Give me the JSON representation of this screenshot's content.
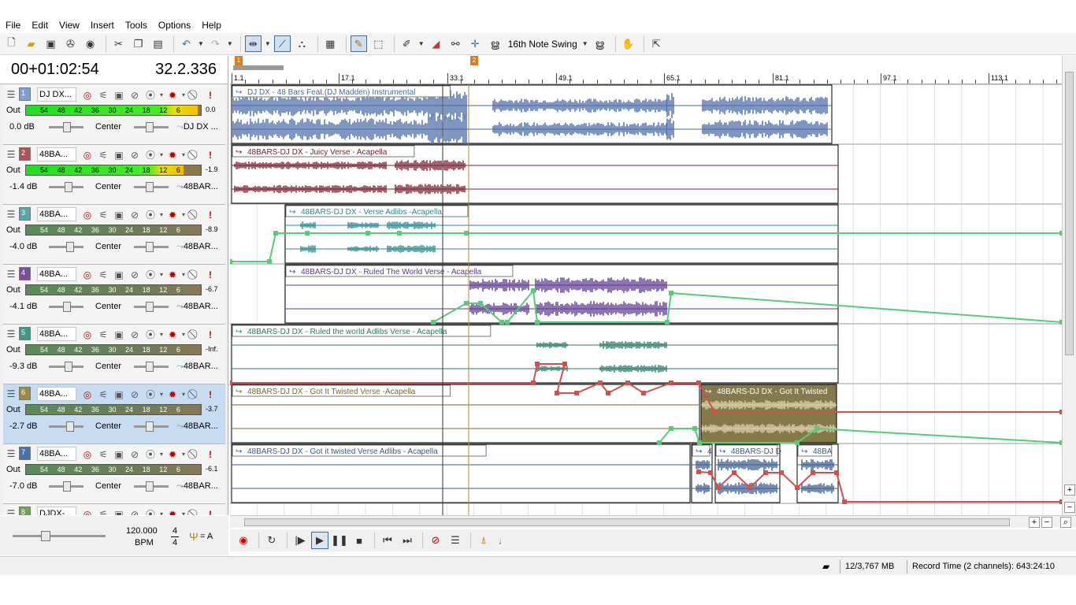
{
  "menu": [
    "File",
    "Edit",
    "View",
    "Insert",
    "Tools",
    "Options",
    "Help"
  ],
  "toolbar": {
    "swing_label": "16th Note Swing"
  },
  "time": {
    "position": "00+01:02:54",
    "measure": "32.2.336"
  },
  "tracks": [
    {
      "num": "1",
      "name": "DJ DX...",
      "peak": "0.0",
      "volume": "0.0 dB",
      "pan": "Center",
      "output": "DJ DX ...",
      "color": "#7c9fd4",
      "meter_level": 0.98
    },
    {
      "num": "2",
      "name": "48BA...",
      "peak": "-1.9",
      "volume": "-1.4 dB",
      "pan": "Center",
      "output": "48BAR...",
      "color": "#b05058",
      "meter_level": 0.9
    },
    {
      "num": "3",
      "name": "48BA...",
      "peak": "-8.9",
      "volume": "-4.0 dB",
      "pan": "Center",
      "output": "48BAR...",
      "color": "#58a7a0",
      "meter_level": 0.0
    },
    {
      "num": "4",
      "name": "48BA...",
      "peak": "-6.7",
      "volume": "-4.1 dB",
      "pan": "Center",
      "output": "48BAR...",
      "color": "#7a4fa0",
      "meter_level": 0.0
    },
    {
      "num": "5",
      "name": "48BA...",
      "peak": "-Inf.",
      "volume": "-9.3 dB",
      "pan": "Center",
      "output": "48BAR...",
      "color": "#3f9a85",
      "meter_level": 0.0
    },
    {
      "num": "6",
      "name": "48BA...",
      "peak": "-3.7",
      "volume": "-2.7 dB",
      "pan": "Center",
      "output": "48BAR...",
      "color": "#9a8a4a",
      "meter_level": 0.0
    },
    {
      "num": "7",
      "name": "48BA...",
      "peak": "-6.1",
      "volume": "-7.0 dB",
      "pan": "Center",
      "output": "48BAR...",
      "color": "#4a70a8",
      "meter_level": 0.0
    },
    {
      "num": "8",
      "name": "DJDX-..."
    }
  ],
  "meter_ticks": [
    "54",
    "48",
    "42",
    "36",
    "30",
    "24",
    "18",
    "12",
    "6"
  ],
  "out_label": "Out",
  "tempo": {
    "bpm": "120.000",
    "bpm_label": "BPM",
    "ts_num": "4",
    "ts_den": "4",
    "fork_label": "= A"
  },
  "ruler": {
    "labels": [
      "1.1",
      "17.1",
      "33.1",
      "49.1",
      "65.1",
      "81.1",
      "97.1",
      "113.1"
    ],
    "marker1": "1",
    "marker2": "2"
  },
  "clips": [
    "DJ DX - 48 Bars Feat.(DJ Madden) Instrumental",
    "48BARS-DJ DX - Juicy Verse - Acapella",
    "48BARS-DJ DX - Verse Adlibs -Acapella",
    "48BARS-DJ DX - Ruled The World Verse - Acapella",
    "48BARS-DJ DX - Ruled the world Adlibs Verse - Acapella",
    "48BARS-DJ DX - Got It Twisted Verse -Acapella",
    "48BARS-DJ DX - Got It Twisted",
    "48BARS-DJ DX - Got it twisted Verse Adlibs - Acapella",
    "4",
    "48BARS-DJ D",
    "48BA"
  ],
  "status": {
    "memory": "12/3,767 MB",
    "record_time": "Record Time (2 channels): 643:24:10"
  }
}
